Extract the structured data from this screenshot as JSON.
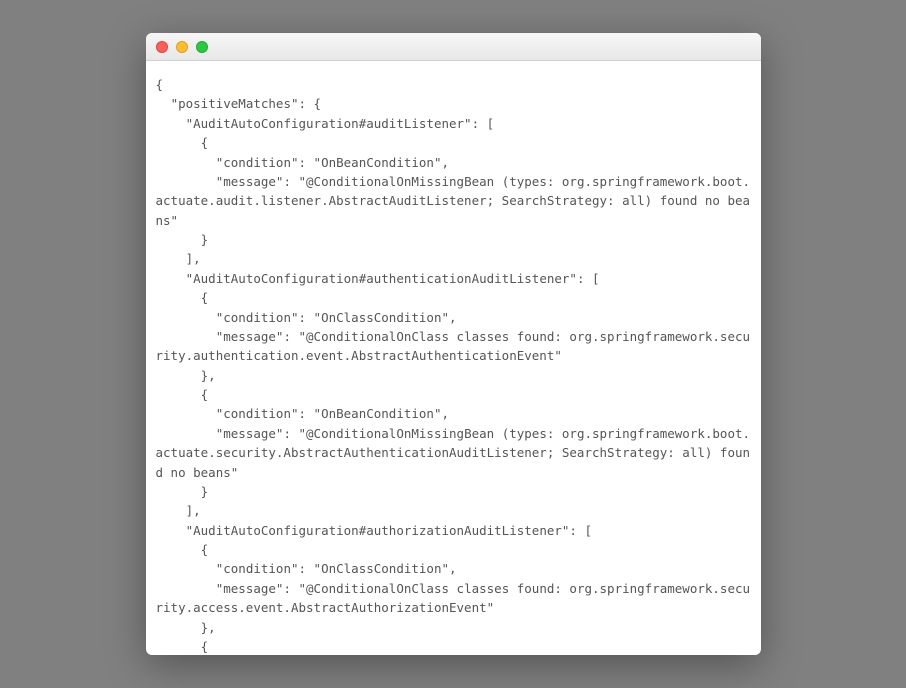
{
  "window": {
    "traffic_lights": {
      "close": "close-icon",
      "minimize": "minimize-icon",
      "maximize": "maximize-icon"
    }
  },
  "code_text": "{\n  \"positiveMatches\": {\n    \"AuditAutoConfiguration#auditListener\": [\n      {\n        \"condition\": \"OnBeanCondition\",\n        \"message\": \"@ConditionalOnMissingBean (types: org.springframework.boot.actuate.audit.listener.AbstractAuditListener; SearchStrategy: all) found no beans\"\n      }\n    ],\n    \"AuditAutoConfiguration#authenticationAuditListener\": [\n      {\n        \"condition\": \"OnClassCondition\",\n        \"message\": \"@ConditionalOnClass classes found: org.springframework.security.authentication.event.AbstractAuthenticationEvent\"\n      },\n      {\n        \"condition\": \"OnBeanCondition\",\n        \"message\": \"@ConditionalOnMissingBean (types: org.springframework.boot.actuate.security.AbstractAuthenticationAuditListener; SearchStrategy: all) found no beans\"\n      }\n    ],\n    \"AuditAutoConfiguration#authorizationAuditListener\": [\n      {\n        \"condition\": \"OnClassCondition\",\n        \"message\": \"@ConditionalOnClass classes found: org.springframework.security.access.event.AbstractAuthorizationEvent\"\n      },\n      {"
}
